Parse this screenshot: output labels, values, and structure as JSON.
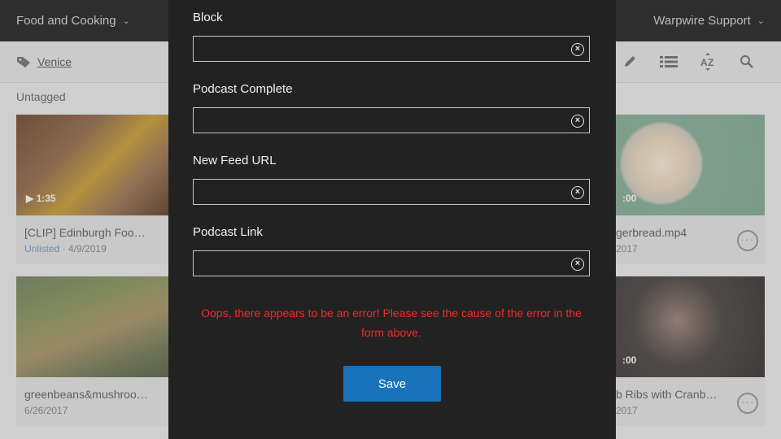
{
  "topbar": {
    "channel": "Food and Cooking",
    "support": "Warpwire Support"
  },
  "subbar": {
    "tag_label": "Venice"
  },
  "section": {
    "label": "Untagged"
  },
  "cards": [
    {
      "title": "[CLIP] Edinburgh Foo…",
      "status": "Unlisted",
      "date": "· 4/9/2019",
      "duration": "▶ 1:35"
    },
    {
      "title": "gerbread.mp4",
      "date": "2017",
      "duration": ":00"
    },
    {
      "title": "greenbeans&mushroo…",
      "date": "6/26/2017"
    },
    {
      "title": "b Ribs with Cranb…",
      "date": "2017",
      "duration": ":00"
    }
  ],
  "modal": {
    "fields": [
      {
        "label": "Block",
        "value": ""
      },
      {
        "label": "Podcast Complete",
        "value": ""
      },
      {
        "label": "New Feed URL",
        "value": ""
      },
      {
        "label": "Podcast Link",
        "value": ""
      }
    ],
    "error": "Oops, there appears to be an error! Please see the cause of the error in the form above.",
    "save_label": "Save"
  },
  "colors": {
    "accent": "#1a73b8",
    "error": "#ef2b2b",
    "modal_bg": "#222222"
  }
}
